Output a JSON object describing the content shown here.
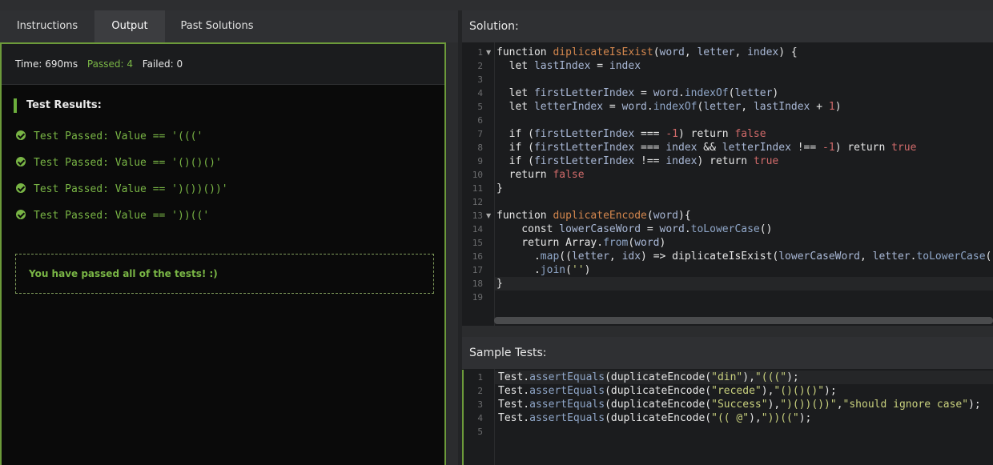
{
  "tabs": [
    {
      "label": "Instructions"
    },
    {
      "label": "Output"
    },
    {
      "label": "Past Solutions"
    }
  ],
  "summary": {
    "time": "Time: 690ms",
    "passed": "Passed: 4",
    "failed": "Failed: 0"
  },
  "results": {
    "title": "Test Results:",
    "tests": [
      {
        "text": "Test Passed: Value == '((('"
      },
      {
        "text": "Test Passed: Value == '()()()'"
      },
      {
        "text": "Test Passed: Value == ')())())'"
      },
      {
        "text": "Test Passed: Value == '))(('"
      }
    ],
    "message": "You have passed all of the tests! :)"
  },
  "solution": {
    "title": "Solution:",
    "line_numbers": [
      "1",
      "2",
      "3",
      "4",
      "5",
      "6",
      "7",
      "8",
      "9",
      "10",
      "11",
      "12",
      "13",
      "14",
      "15",
      "16",
      "17",
      "18",
      "19"
    ],
    "lines": [
      [
        [
          "kw",
          "function "
        ],
        [
          "fn",
          "diplicateIsExist"
        ],
        [
          "kw",
          "("
        ],
        [
          "var",
          "word"
        ],
        [
          "kw",
          ", "
        ],
        [
          "var",
          "letter"
        ],
        [
          "kw",
          ", "
        ],
        [
          "var",
          "index"
        ],
        [
          "kw",
          ") {"
        ]
      ],
      [
        [
          "kw",
          "  let "
        ],
        [
          "var",
          "lastIndex"
        ],
        [
          "kw",
          " = "
        ],
        [
          "var",
          "index"
        ]
      ],
      [],
      [
        [
          "kw",
          "  let "
        ],
        [
          "var",
          "firstLetterIndex"
        ],
        [
          "kw",
          " = "
        ],
        [
          "var",
          "word"
        ],
        [
          "kw",
          "."
        ],
        [
          "meth",
          "indexOf"
        ],
        [
          "kw",
          "("
        ],
        [
          "var",
          "letter"
        ],
        [
          "kw",
          ")"
        ]
      ],
      [
        [
          "kw",
          "  let "
        ],
        [
          "var",
          "letterIndex"
        ],
        [
          "kw",
          " = "
        ],
        [
          "var",
          "word"
        ],
        [
          "kw",
          "."
        ],
        [
          "meth",
          "indexOf"
        ],
        [
          "kw",
          "("
        ],
        [
          "var",
          "letter"
        ],
        [
          "kw",
          ", "
        ],
        [
          "var",
          "lastIndex"
        ],
        [
          "kw",
          " + "
        ],
        [
          "num",
          "1"
        ],
        [
          "kw",
          ")"
        ]
      ],
      [],
      [
        [
          "kw",
          "  if ("
        ],
        [
          "var",
          "firstLetterIndex"
        ],
        [
          "kw",
          " === "
        ],
        [
          "num",
          "-1"
        ],
        [
          "kw",
          ") return "
        ],
        [
          "lit",
          "false"
        ]
      ],
      [
        [
          "kw",
          "  if ("
        ],
        [
          "var",
          "firstLetterIndex"
        ],
        [
          "kw",
          " === "
        ],
        [
          "var",
          "index"
        ],
        [
          "kw",
          " && "
        ],
        [
          "var",
          "letterIndex"
        ],
        [
          "kw",
          " !== "
        ],
        [
          "num",
          "-1"
        ],
        [
          "kw",
          ") return "
        ],
        [
          "lit",
          "true"
        ]
      ],
      [
        [
          "kw",
          "  if ("
        ],
        [
          "var",
          "firstLetterIndex"
        ],
        [
          "kw",
          " !== "
        ],
        [
          "var",
          "index"
        ],
        [
          "kw",
          ") return "
        ],
        [
          "lit",
          "true"
        ]
      ],
      [
        [
          "kw",
          "  return "
        ],
        [
          "lit",
          "false"
        ]
      ],
      [
        [
          "kw",
          "}"
        ]
      ],
      [],
      [
        [
          "kw",
          "function "
        ],
        [
          "fn",
          "duplicateEncode"
        ],
        [
          "kw",
          "("
        ],
        [
          "var",
          "word"
        ],
        [
          "kw",
          "){"
        ]
      ],
      [
        [
          "kw",
          "    const "
        ],
        [
          "var",
          "lowerCaseWord"
        ],
        [
          "kw",
          " = "
        ],
        [
          "var",
          "word"
        ],
        [
          "kw",
          "."
        ],
        [
          "meth",
          "toLowerCase"
        ],
        [
          "kw",
          "()"
        ]
      ],
      [
        [
          "kw",
          "    return Array."
        ],
        [
          "meth",
          "from"
        ],
        [
          "kw",
          "("
        ],
        [
          "var",
          "word"
        ],
        [
          "kw",
          ")"
        ]
      ],
      [
        [
          "kw",
          "      ."
        ],
        [
          "meth",
          "map"
        ],
        [
          "kw",
          "(("
        ],
        [
          "var",
          "letter"
        ],
        [
          "kw",
          ", "
        ],
        [
          "var",
          "idx"
        ],
        [
          "kw",
          ") => diplicateIsExist("
        ],
        [
          "var",
          "lowerCaseWord"
        ],
        [
          "kw",
          ", "
        ],
        [
          "var",
          "letter"
        ],
        [
          "kw",
          "."
        ],
        [
          "meth",
          "toLowerCase"
        ],
        [
          "kw",
          "(),"
        ]
      ],
      [
        [
          "kw",
          "      ."
        ],
        [
          "meth",
          "join"
        ],
        [
          "kw",
          "("
        ],
        [
          "str",
          "''"
        ],
        [
          "kw",
          ")"
        ]
      ],
      [
        [
          "kw",
          "}"
        ]
      ],
      []
    ]
  },
  "sample_tests": {
    "title": "Sample Tests:",
    "line_numbers": [
      "1",
      "2",
      "3",
      "4",
      "5"
    ],
    "lines": [
      [
        [
          "kw",
          "Test."
        ],
        [
          "meth",
          "assertEquals"
        ],
        [
          "kw",
          "(duplicateEncode("
        ],
        [
          "str",
          "\"din\""
        ],
        [
          "kw",
          "),"
        ],
        [
          "str",
          "\"(((\""
        ],
        [
          "kw",
          ");"
        ]
      ],
      [
        [
          "kw",
          "Test."
        ],
        [
          "meth",
          "assertEquals"
        ],
        [
          "kw",
          "(duplicateEncode("
        ],
        [
          "str",
          "\"recede\""
        ],
        [
          "kw",
          "),"
        ],
        [
          "str",
          "\"()()()\""
        ],
        [
          "kw",
          ");"
        ]
      ],
      [
        [
          "kw",
          "Test."
        ],
        [
          "meth",
          "assertEquals"
        ],
        [
          "kw",
          "(duplicateEncode("
        ],
        [
          "str",
          "\"Success\""
        ],
        [
          "kw",
          "),"
        ],
        [
          "str",
          "\")())())\""
        ],
        [
          "kw",
          ","
        ],
        [
          "str",
          "\"should ignore case\""
        ],
        [
          "kw",
          ");"
        ]
      ],
      [
        [
          "kw",
          "Test."
        ],
        [
          "meth",
          "assertEquals"
        ],
        [
          "kw",
          "(duplicateEncode("
        ],
        [
          "str",
          "\"(( @\""
        ],
        [
          "kw",
          "),"
        ],
        [
          "str",
          "\"))((\""
        ],
        [
          "kw",
          ");"
        ]
      ],
      []
    ]
  },
  "colors": {
    "accent": "#6c9a3a",
    "pass_text": "#79b545"
  }
}
